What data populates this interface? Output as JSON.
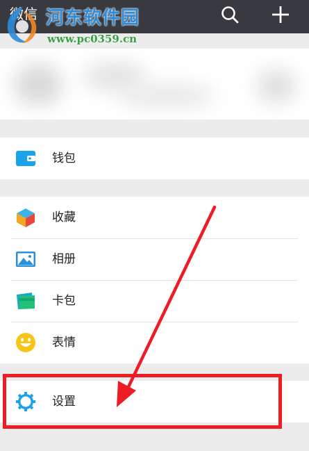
{
  "header": {
    "title": "微信",
    "search_icon": "search-icon",
    "add_icon": "plus-icon"
  },
  "watermark": {
    "title": "河东软件园",
    "url": "www.pc0359.cn"
  },
  "menu": {
    "wallet": {
      "label": "钱包",
      "icon": "wallet-icon",
      "color": "#1aa3e8"
    },
    "favorites": {
      "label": "收藏",
      "icon": "cube-icon"
    },
    "album": {
      "label": "相册",
      "icon": "photo-icon",
      "color": "#2b8fdc"
    },
    "cards": {
      "label": "卡包",
      "icon": "card-icon"
    },
    "stickers": {
      "label": "表情",
      "icon": "smile-icon",
      "color": "#f5c518"
    },
    "settings": {
      "label": "设置",
      "icon": "gear-icon",
      "color": "#1aa3e8"
    }
  },
  "annotation": {
    "color": "#ee1c24"
  }
}
